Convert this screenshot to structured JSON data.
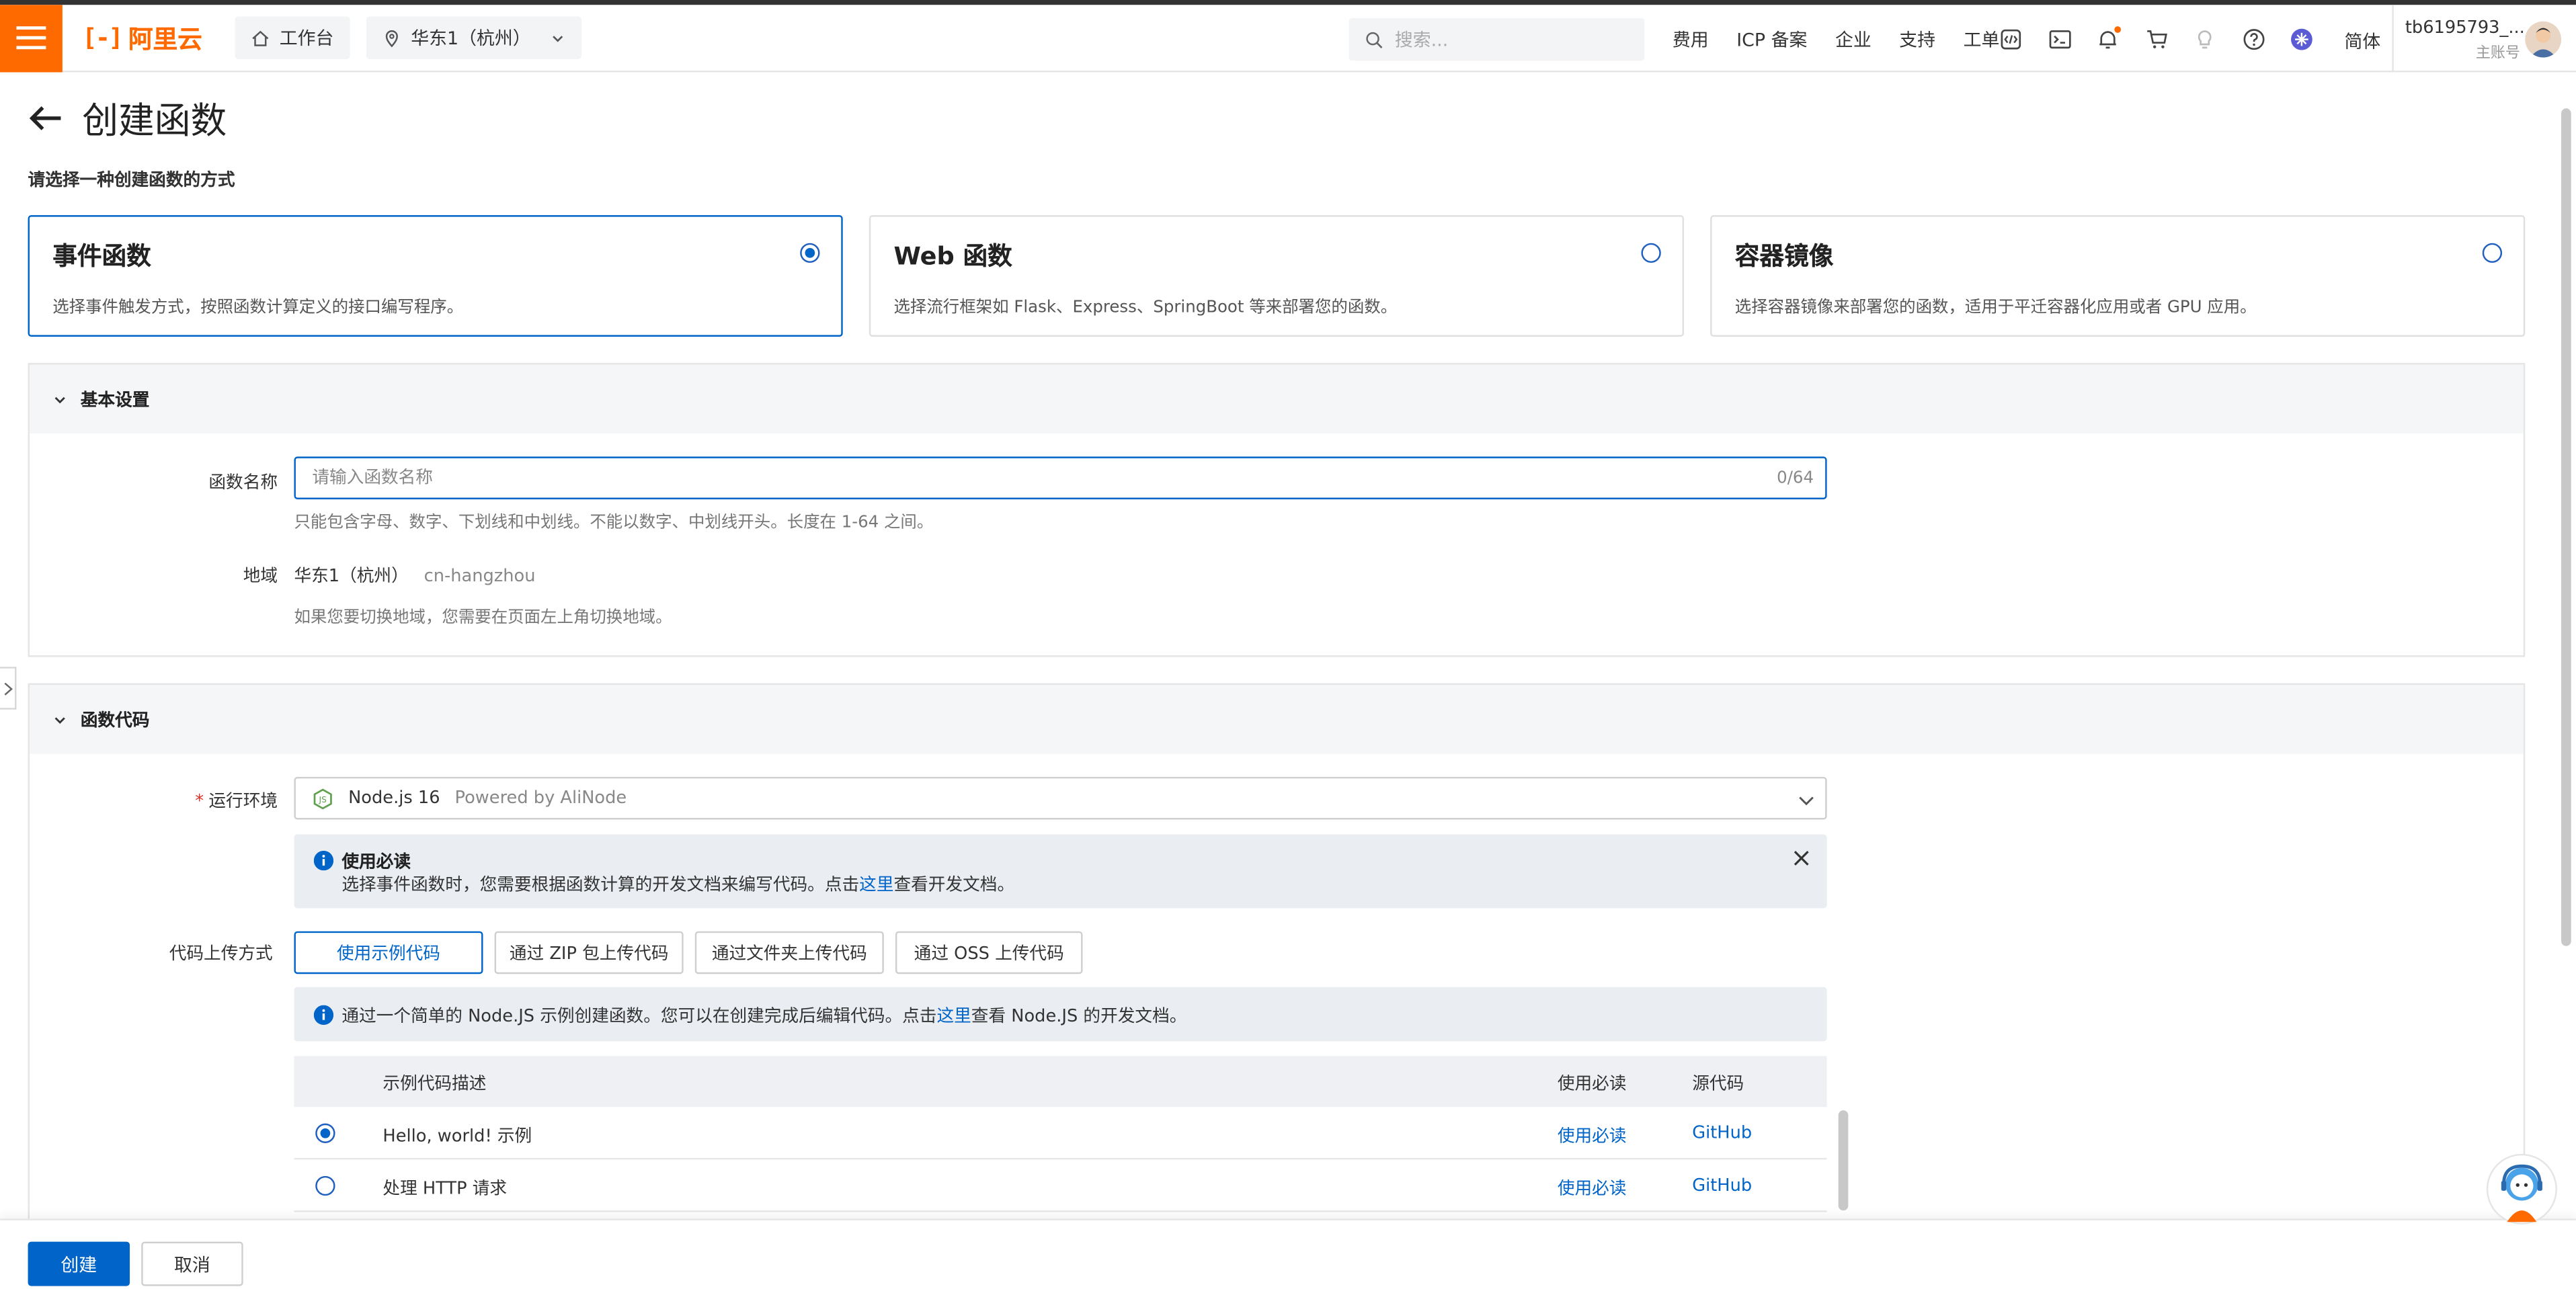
{
  "brand": {
    "mark": "[-]",
    "name": "阿里云"
  },
  "topbar": {
    "workbench": "工作台",
    "region": "华东1（杭州）",
    "search_placeholder": "搜索...",
    "links": [
      "费用",
      "ICP 备案",
      "企业",
      "支持",
      "工单"
    ],
    "lang": "简体",
    "account_name": "tb6195793_...",
    "account_role": "主账号"
  },
  "colors": {
    "brand": "#ff6a00",
    "primary": "#0064c8"
  },
  "page": {
    "title": "创建函数",
    "choose_hint": "请选择一种创建函数的方式"
  },
  "cards": [
    {
      "title": "事件函数",
      "desc": "选择事件触发方式，按照函数计算定义的接口编写程序。",
      "selected": true
    },
    {
      "title": "Web 函数",
      "desc": "选择流行框架如 Flask、Express、SpringBoot 等来部署您的函数。",
      "selected": false
    },
    {
      "title": "容器镜像",
      "desc": "选择容器镜像来部署您的函数，适用于平迁容器化应用或者 GPU 应用。",
      "selected": false
    }
  ],
  "basic": {
    "header": "基本设置",
    "name_label": "函数名称",
    "name_placeholder": "请输入函数名称",
    "name_count": "0/64",
    "name_help": "只能包含字母、数字、下划线和中划线。不能以数字、中划线开头。长度在 1-64 之间。",
    "region_label": "地域",
    "region_value": "华东1（杭州）",
    "region_code": "cn-hangzhou",
    "region_help": "如果您要切换地域，您需要在页面左上角切换地域。"
  },
  "code": {
    "header": "函数代码",
    "runtime_label": "运行环境",
    "runtime_value": "Node.js 16",
    "runtime_sub": "Powered by AliNode",
    "notice_title": "使用必读",
    "notice_pre": "选择事件函数时，您需要根据函数计算的开发文档来编写代码。点击",
    "notice_link": "这里",
    "notice_post": "查看开发文档。",
    "upload_label": "代码上传方式",
    "upload_tabs": [
      "使用示例代码",
      "通过 ZIP 包上传代码",
      "通过文件夹上传代码",
      "通过 OSS 上传代码"
    ],
    "info_pre": "通过一个简单的 Node.JS 示例创建函数。您可以在创建完成后编辑代码。点击",
    "info_link": "这里",
    "info_post": "查看 Node.JS 的开发文档。",
    "table_headers": [
      "示例代码描述",
      "使用必读",
      "源代码"
    ],
    "rows": [
      {
        "desc": "Hello, world! 示例",
        "readme": "使用必读",
        "source": "GitHub",
        "selected": true
      },
      {
        "desc": "处理 HTTP 请求",
        "readme": "使用必读",
        "source": "GitHub",
        "selected": false
      }
    ]
  },
  "footer": {
    "create": "创建",
    "cancel": "取消"
  }
}
